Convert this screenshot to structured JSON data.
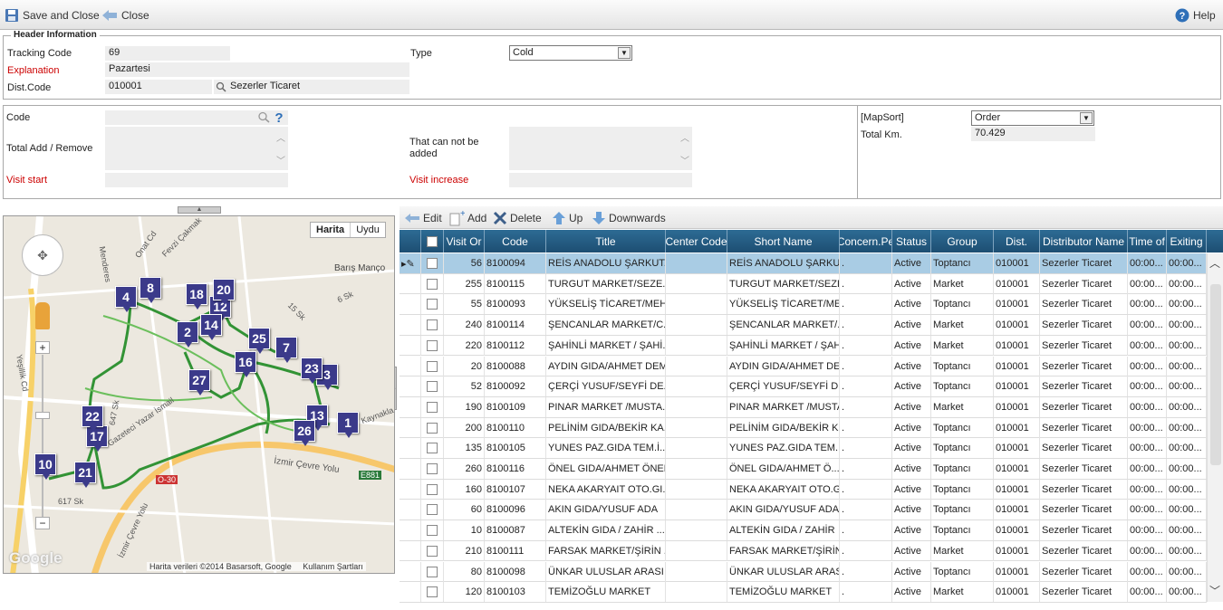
{
  "toolbar": {
    "save_close": "Save and Close",
    "close": "Close",
    "help": "Help"
  },
  "header": {
    "legend": "Header Information",
    "tracking_code_label": "Tracking Code",
    "tracking_code": "69",
    "explanation_label": "Explanation",
    "explanation": "Pazartesi",
    "dist_code_label": "Dist.Code",
    "dist_code": "010001",
    "dist_name": "Sezerler Ticaret",
    "type_label": "Type",
    "type_value": "Cold"
  },
  "form2": {
    "code_label": "Code",
    "total_add_remove_label": "Total Add / Remove",
    "visit_start_label": "Visit start",
    "cannot_add_label": "That can not be added",
    "visit_increase_label": "Visit increase",
    "mapsort_label": "[MapSort]",
    "mapsort_value": "Order",
    "total_km_label": "Total Km.",
    "total_km": "70.429"
  },
  "map": {
    "btn_map": "Harita",
    "btn_sat": "Uydu",
    "attribution": "Harita verileri ©2014 Basarsoft, Google",
    "terms": "Kullanım Şartları",
    "logo": "Google",
    "labels": [
      "Barış Manço",
      "İzmir Çevre Yolu",
      "Gazeteci Yazar İsmail",
      "Yeşillik Cd",
      "Onat Cd",
      "Fevzi Çakmak",
      "15 Sk",
      "6 Sk",
      "617 Sk",
      "647 Sk",
      "O-30",
      "E881",
      "Menderes",
      "Kaynakla",
      "Yeşillik Cd",
      "İzmir Çevre Yolu"
    ],
    "markers": [
      "1",
      "2",
      "3",
      "4",
      "7",
      "8",
      "10",
      "12",
      "13",
      "14",
      "16",
      "17",
      "18",
      "20",
      "21",
      "22",
      "23",
      "25",
      "26",
      "27"
    ]
  },
  "grid_toolbar": {
    "edit": "Edit",
    "add": "Add",
    "delete": "Delete",
    "up": "Up",
    "down": "Downwards"
  },
  "grid": {
    "headers": [
      "Visit Or",
      "Code",
      "Title",
      "Center Code",
      "Short Name",
      "Concern.Pe",
      "Status",
      "Group",
      "Dist.",
      "Distributor Name",
      "Time of",
      "Exiting"
    ],
    "rows": [
      {
        "visit": "56",
        "code": "8100094",
        "title": "REİS ANADOLU ŞARKUT...",
        "center": "",
        "short": "REİS ANADOLU ŞARKUTE",
        "concern": ".",
        "status": "Active",
        "group": "Toptancı",
        "dist": "010001",
        "dname": "Sezerler Ticaret",
        "time": "00:00...",
        "exit": "00:00..."
      },
      {
        "visit": "255",
        "code": "8100115",
        "title": "TURGUT MARKET/SEZE...",
        "center": "",
        "short": "TURGUT MARKET/SEZER",
        "concern": ".",
        "status": "Active",
        "group": "Market",
        "dist": "010001",
        "dname": "Sezerler Ticaret",
        "time": "00:00...",
        "exit": "00:00..."
      },
      {
        "visit": "55",
        "code": "8100093",
        "title": "YÜKSELİŞ TİCARET/MEH...",
        "center": "",
        "short": "YÜKSELİŞ TİCARET/MEH",
        "concern": ".",
        "status": "Active",
        "group": "Toptancı",
        "dist": "010001",
        "dname": "Sezerler Ticaret",
        "time": "00:00...",
        "exit": "00:00..."
      },
      {
        "visit": "240",
        "code": "8100114",
        "title": "ŞENCANLAR MARKET/C...",
        "center": "",
        "short": "ŞENCANLAR MARKET/...",
        "concern": ".",
        "status": "Active",
        "group": "Market",
        "dist": "010001",
        "dname": "Sezerler Ticaret",
        "time": "00:00...",
        "exit": "00:00..."
      },
      {
        "visit": "220",
        "code": "8100112",
        "title": "ŞAHİNLİ MARKET / ŞAHİ...",
        "center": "",
        "short": "ŞAHİNLİ MARKET / ŞAH",
        "concern": ".",
        "status": "Active",
        "group": "Market",
        "dist": "010001",
        "dname": "Sezerler Ticaret",
        "time": "00:00...",
        "exit": "00:00..."
      },
      {
        "visit": "20",
        "code": "8100088",
        "title": "AYDIN GIDA/AHMET DEMİR",
        "center": "",
        "short": "AYDIN GIDA/AHMET DEM",
        "concern": ".",
        "status": "Active",
        "group": "Toptancı",
        "dist": "010001",
        "dname": "Sezerler Ticaret",
        "time": "00:00...",
        "exit": "00:00..."
      },
      {
        "visit": "52",
        "code": "8100092",
        "title": "ÇERÇİ YUSUF/SEYFİ DE...",
        "center": "",
        "short": "ÇERÇİ YUSUF/SEYFİ DE",
        "concern": ".",
        "status": "Active",
        "group": "Toptancı",
        "dist": "010001",
        "dname": "Sezerler Ticaret",
        "time": "00:00...",
        "exit": "00:00..."
      },
      {
        "visit": "190",
        "code": "8100109",
        "title": "PINAR MARKET /MUSTA...",
        "center": "",
        "short": "PINAR MARKET /MUSTAF",
        "concern": ".",
        "status": "Active",
        "group": "Market",
        "dist": "010001",
        "dname": "Sezerler Ticaret",
        "time": "00:00...",
        "exit": "00:00..."
      },
      {
        "visit": "200",
        "code": "8100110",
        "title": "PELİNİM GIDA/BEKİR KA...",
        "center": "",
        "short": "PELİNİM GIDA/BEKİR K",
        "concern": ".",
        "status": "Active",
        "group": "Toptancı",
        "dist": "010001",
        "dname": "Sezerler Ticaret",
        "time": "00:00...",
        "exit": "00:00..."
      },
      {
        "visit": "135",
        "code": "8100105",
        "title": "YUNES PAZ.GIDA TEM.İ...",
        "center": "",
        "short": "YUNES PAZ.GIDA TEM.İ",
        "concern": ".",
        "status": "Active",
        "group": "Toptancı",
        "dist": "010001",
        "dname": "Sezerler Ticaret",
        "time": "00:00...",
        "exit": "00:00..."
      },
      {
        "visit": "260",
        "code": "8100116",
        "title": "ÖNEL GIDA/AHMET ÖNEL",
        "center": "",
        "short": "ÖNEL GIDA/AHMET Ö...",
        "concern": ".",
        "status": "Active",
        "group": "Toptancı",
        "dist": "010001",
        "dname": "Sezerler Ticaret",
        "time": "00:00...",
        "exit": "00:00..."
      },
      {
        "visit": "160",
        "code": "8100107",
        "title": "NEKA AKARYAIT OTO.GI...",
        "center": "",
        "short": "NEKA AKARYAIT OTO.GI",
        "concern": ".",
        "status": "Active",
        "group": "Toptancı",
        "dist": "010001",
        "dname": "Sezerler Ticaret",
        "time": "00:00...",
        "exit": "00:00..."
      },
      {
        "visit": "60",
        "code": "8100096",
        "title": "AKIN GIDA/YUSUF ADA",
        "center": "",
        "short": "AKIN GIDA/YUSUF ADA",
        "concern": ".",
        "status": "Active",
        "group": "Toptancı",
        "dist": "010001",
        "dname": "Sezerler Ticaret",
        "time": "00:00...",
        "exit": "00:00..."
      },
      {
        "visit": "10",
        "code": "8100087",
        "title": "ALTEKİN GIDA / ZAHİR ...",
        "center": "",
        "short": "ALTEKİN GIDA / ZAHİR",
        "concern": ".",
        "status": "Active",
        "group": "Toptancı",
        "dist": "010001",
        "dname": "Sezerler Ticaret",
        "time": "00:00...",
        "exit": "00:00..."
      },
      {
        "visit": "210",
        "code": "8100111",
        "title": "FARSAK MARKET/ŞİRİN ...",
        "center": "",
        "short": "FARSAK MARKET/ŞİRİN",
        "concern": ".",
        "status": "Active",
        "group": "Market",
        "dist": "010001",
        "dname": "Sezerler Ticaret",
        "time": "00:00...",
        "exit": "00:00..."
      },
      {
        "visit": "80",
        "code": "8100098",
        "title": "ÜNKAR ULUSLAR ARASI ...",
        "center": "",
        "short": "ÜNKAR ULUSLAR ARASI",
        "concern": ".",
        "status": "Active",
        "group": "Toptancı",
        "dist": "010001",
        "dname": "Sezerler Ticaret",
        "time": "00:00...",
        "exit": "00:00..."
      },
      {
        "visit": "120",
        "code": "8100103",
        "title": "TEMİZOĞLU MARKET",
        "center": "",
        "short": "TEMİZOĞLU MARKET",
        "concern": ".",
        "status": "Active",
        "group": "Market",
        "dist": "010001",
        "dname": "Sezerler Ticaret",
        "time": "00:00...",
        "exit": "00:00..."
      }
    ]
  },
  "colors": {
    "header_bg": "#1d4e72",
    "selected_row": "#a9cce4",
    "marker": "#3b3a8a",
    "route": "#1e8a22",
    "required_label": "#cc0000"
  }
}
